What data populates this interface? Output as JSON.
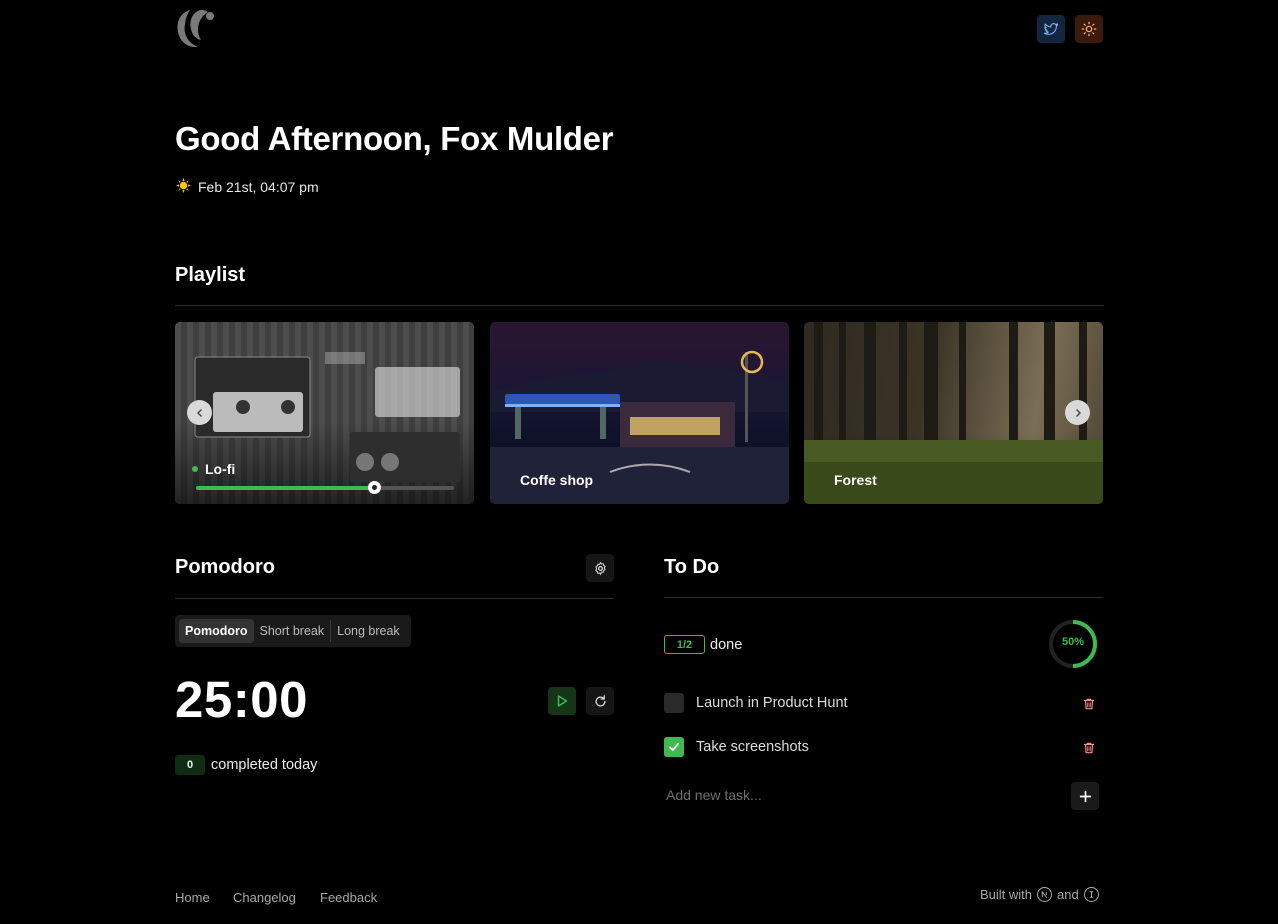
{
  "header": {
    "logo_icon": "crescent-moon-logo",
    "twitter_icon": "twitter-bird-icon",
    "theme_icon": "sun-icon"
  },
  "greeting": {
    "title": "Good Afternoon, Fox Mulder",
    "datetime": "Feb 21st, 04:07 pm",
    "weather_icon": "sun-emoji"
  },
  "playlist": {
    "title": "Playlist",
    "cards": [
      {
        "label": "Lo-fi",
        "active": true,
        "volume": 0.69
      },
      {
        "label": "Coffe shop",
        "active": false
      },
      {
        "label": "Forest",
        "active": false
      }
    ]
  },
  "pomodoro": {
    "title": "Pomodoro",
    "modes": [
      "Pomodoro",
      "Short break",
      "Long break"
    ],
    "active_mode": "Pomodoro",
    "timer": "25:00",
    "completed_count": "0",
    "completed_label": "completed today",
    "accent": "#3fb950"
  },
  "todo": {
    "title": "To Do",
    "done_badge": "1/2",
    "done_label": "done",
    "progress_label": "50%",
    "progress": 0.5,
    "tasks": [
      {
        "label": "Launch in Product Hunt",
        "done": false
      },
      {
        "label": "Take screenshots",
        "done": true
      }
    ],
    "new_task_placeholder": "Add new task..."
  },
  "footer": {
    "links": [
      "Home",
      "Changelog",
      "Feedback"
    ],
    "built_with": "Built with",
    "and": "and"
  }
}
